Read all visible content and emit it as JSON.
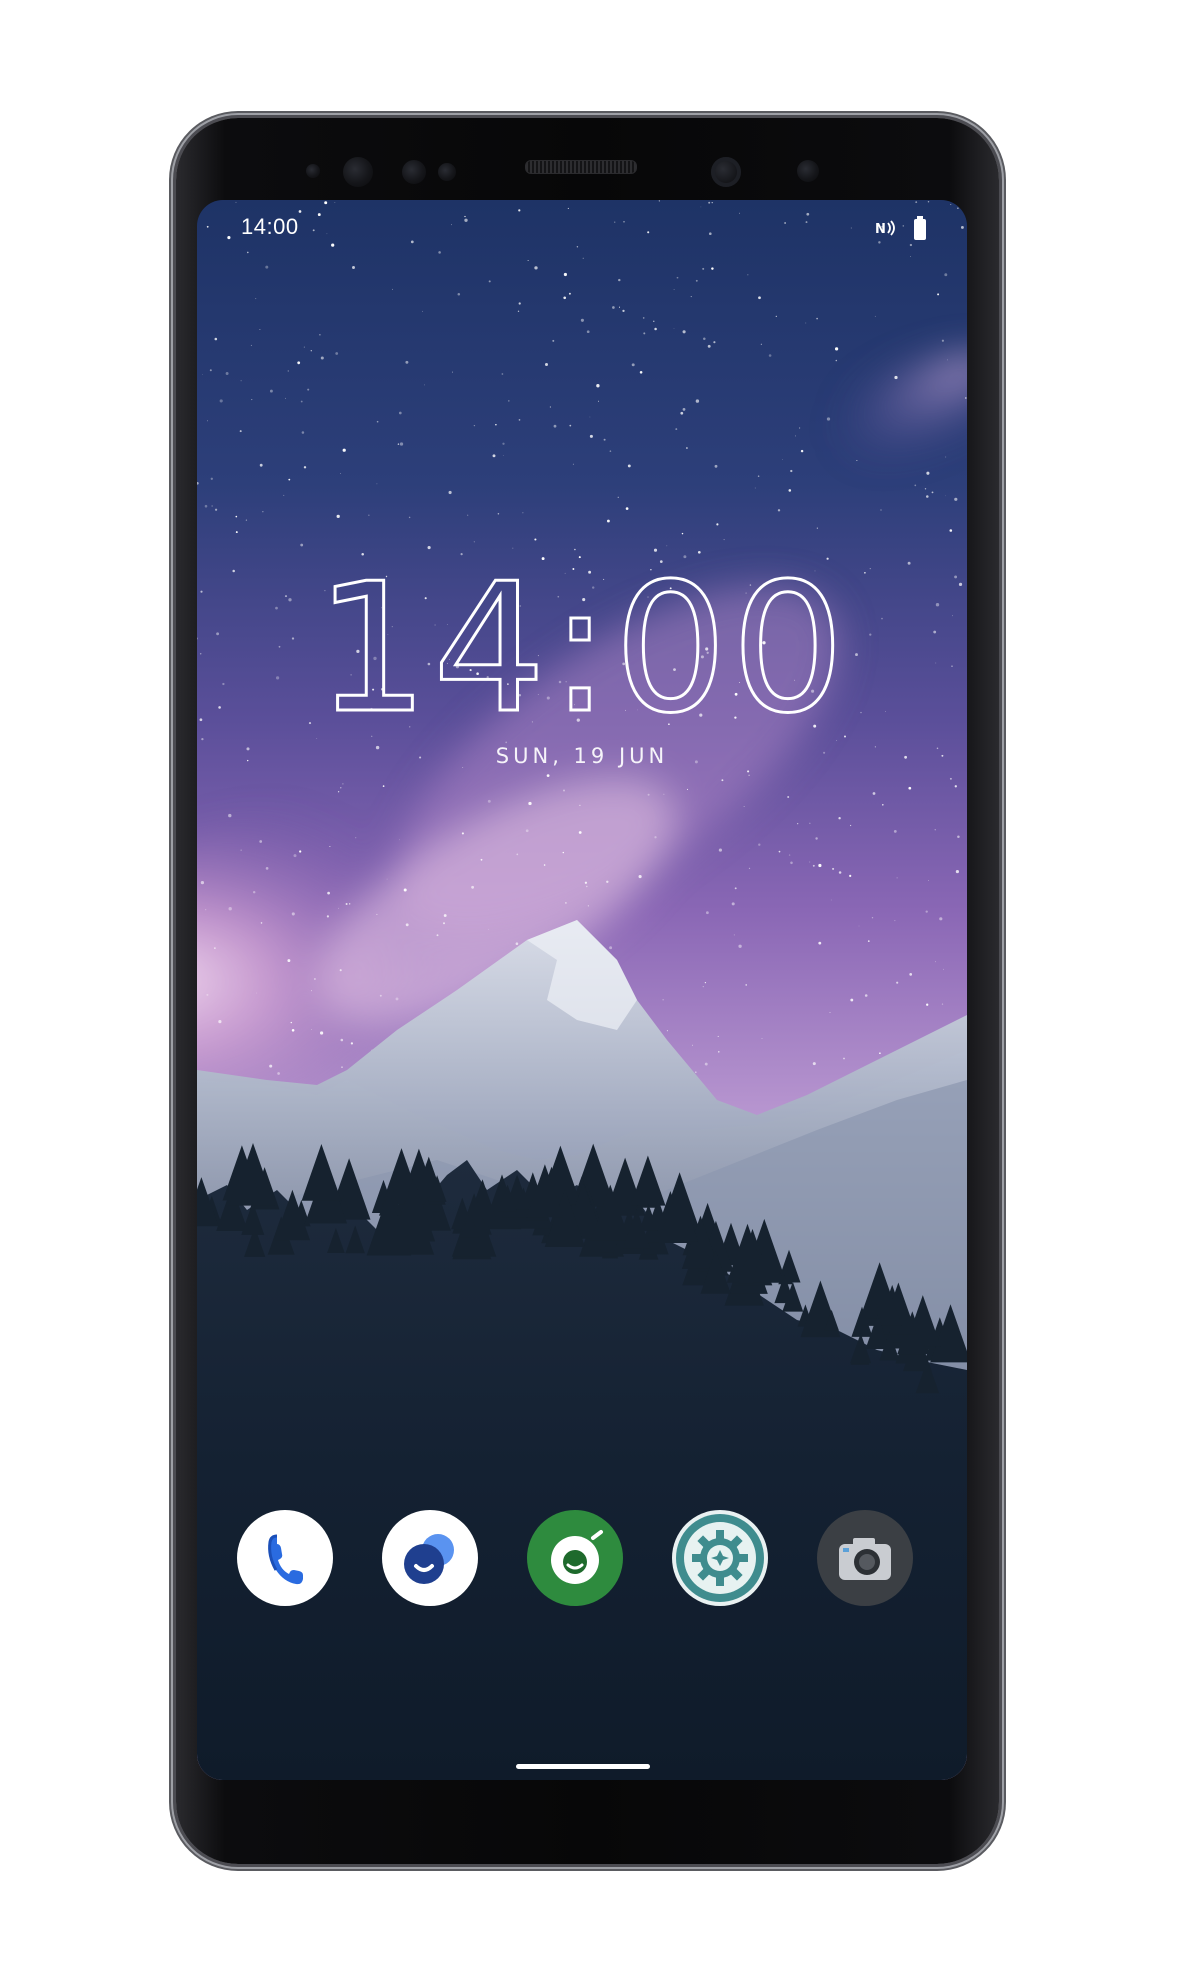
{
  "status_bar": {
    "time": "14:00",
    "icons": [
      "nfc-icon",
      "battery-icon"
    ]
  },
  "lockscreen": {
    "clock": "14:00",
    "date": "SUN, 19 JUN"
  },
  "dock": {
    "apps": [
      {
        "icon": "phone-icon",
        "color": "#1a73e8"
      },
      {
        "icon": "messages-icon",
        "color": "#2c5cc5"
      },
      {
        "icon": "app-store-icon",
        "color": "#2e8b3e"
      },
      {
        "icon": "settings-icon",
        "color": "#3a8a8a"
      },
      {
        "icon": "camera-icon",
        "color": "#4a4d52"
      }
    ]
  },
  "colors": {
    "sky_top": "#243a6e",
    "sky_mid": "#7a5aa8",
    "sky_glow": "#e8c9ee",
    "forest": "#111d2c"
  }
}
